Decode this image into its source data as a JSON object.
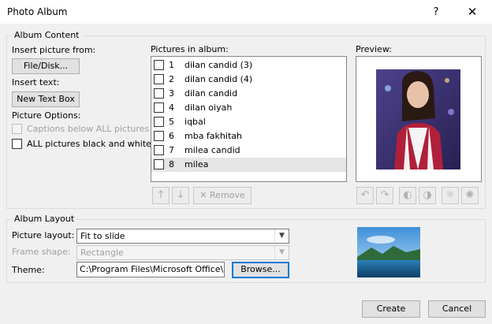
{
  "window": {
    "title": "Photo Album",
    "help": "?",
    "close": "✕"
  },
  "album_content": {
    "title": "Album Content",
    "insert_picture_from": "Insert picture from:",
    "file_disk": "File/Disk...",
    "insert_text": "Insert text:",
    "new_text_box": "New Text Box",
    "picture_options": "Picture Options:",
    "captions_below": "Captions below ALL pictures",
    "black_white": "ALL pictures black and white"
  },
  "pictures": {
    "header": "Pictures in album:",
    "items": [
      {
        "num": "1",
        "name": "dilan candid (3)",
        "checked": false
      },
      {
        "num": "2",
        "name": "dilan candid (4)",
        "checked": false
      },
      {
        "num": "3",
        "name": "dilan candid",
        "checked": false
      },
      {
        "num": "4",
        "name": "dilan oiyah",
        "checked": false
      },
      {
        "num": "5",
        "name": "iqbal",
        "checked": false
      },
      {
        "num": "6",
        "name": "mba fakhitah",
        "checked": false
      },
      {
        "num": "7",
        "name": "milea candid",
        "checked": false
      },
      {
        "num": "8",
        "name": "milea",
        "checked": false,
        "selected": true
      }
    ],
    "move_up_icon": "arrow-up-icon",
    "move_down_icon": "arrow-down-icon",
    "remove": "Remove"
  },
  "preview": {
    "header": "Preview:"
  },
  "album_layout": {
    "title": "Album Layout",
    "picture_layout_label": "Picture layout:",
    "picture_layout_value": "Fit to slide",
    "frame_shape_label": "Frame shape:",
    "frame_shape_value": "Rectangle",
    "theme_label": "Theme:",
    "theme_value": "C:\\Program Files\\Microsoft Office\\ro",
    "browse": "Browse..."
  },
  "footer": {
    "create": "Create",
    "cancel": "Cancel"
  },
  "colors": {
    "accent": "#0078d7",
    "selection": "#e5e5e5",
    "disabled": "#a0a0a0"
  }
}
